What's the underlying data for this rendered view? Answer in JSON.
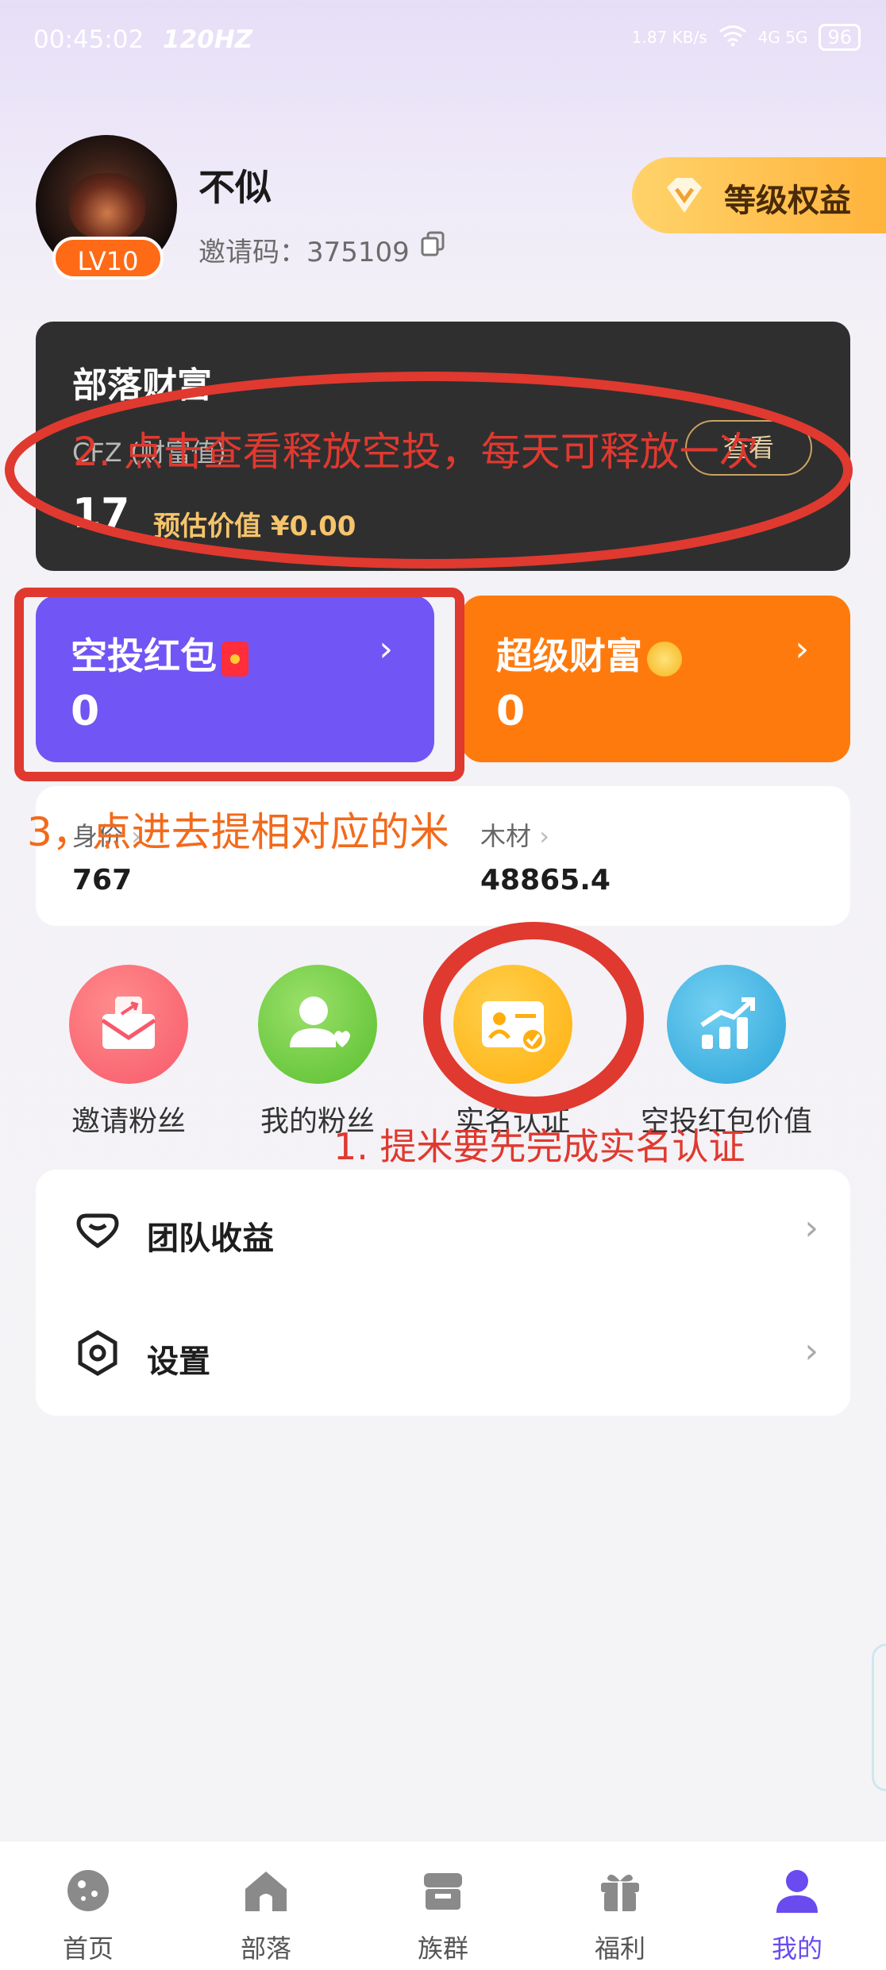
{
  "status_bar": {
    "time": "00:45:02",
    "refresh": "120HZ",
    "net_speed": "1.87 KB/s",
    "network": "4G 5G",
    "battery": "96"
  },
  "profile": {
    "name": "不似",
    "level": "LV10",
    "invite_label": "邀请码：",
    "invite_code": "375109",
    "level_benefits": "等级权益"
  },
  "wealth": {
    "title": "部落财富",
    "subtitle": "CFZ (财富值)",
    "value": "17",
    "estimate": "预估价值 ¥0.00",
    "view_button": "查看"
  },
  "cards": {
    "airdrop": {
      "title": "空投红包",
      "value": "0"
    },
    "super_wealth": {
      "title": "超级财富",
      "value": "0"
    }
  },
  "stats": {
    "worth_label": "身价",
    "worth_value": "767",
    "wood_label": "木材",
    "wood_value": "48865.4"
  },
  "quick_actions": [
    {
      "label": "邀请粉丝",
      "color": "#f7596a"
    },
    {
      "label": "我的粉丝",
      "color": "#6cc93b"
    },
    {
      "label": "实名认证",
      "color": "#ffb814"
    },
    {
      "label": "空投红包价值",
      "color": "#3ab0e3"
    }
  ],
  "menu": [
    {
      "label": "团队收益"
    },
    {
      "label": "设置"
    }
  ],
  "annotations": {
    "note1": "1. 提米要先完成实名认证",
    "note2": "2. 点击查看释放空投，每天可释放一次",
    "note3": "3，点进去提相对应的米",
    "color": "#e0392f"
  },
  "tabbar": [
    {
      "label": "首页"
    },
    {
      "label": "部落"
    },
    {
      "label": "族群"
    },
    {
      "label": "福利"
    },
    {
      "label": "我的"
    }
  ],
  "colors": {
    "accent": "#6a4bf0",
    "orange": "#ff7a0d",
    "purple_card": "#7155f5"
  }
}
